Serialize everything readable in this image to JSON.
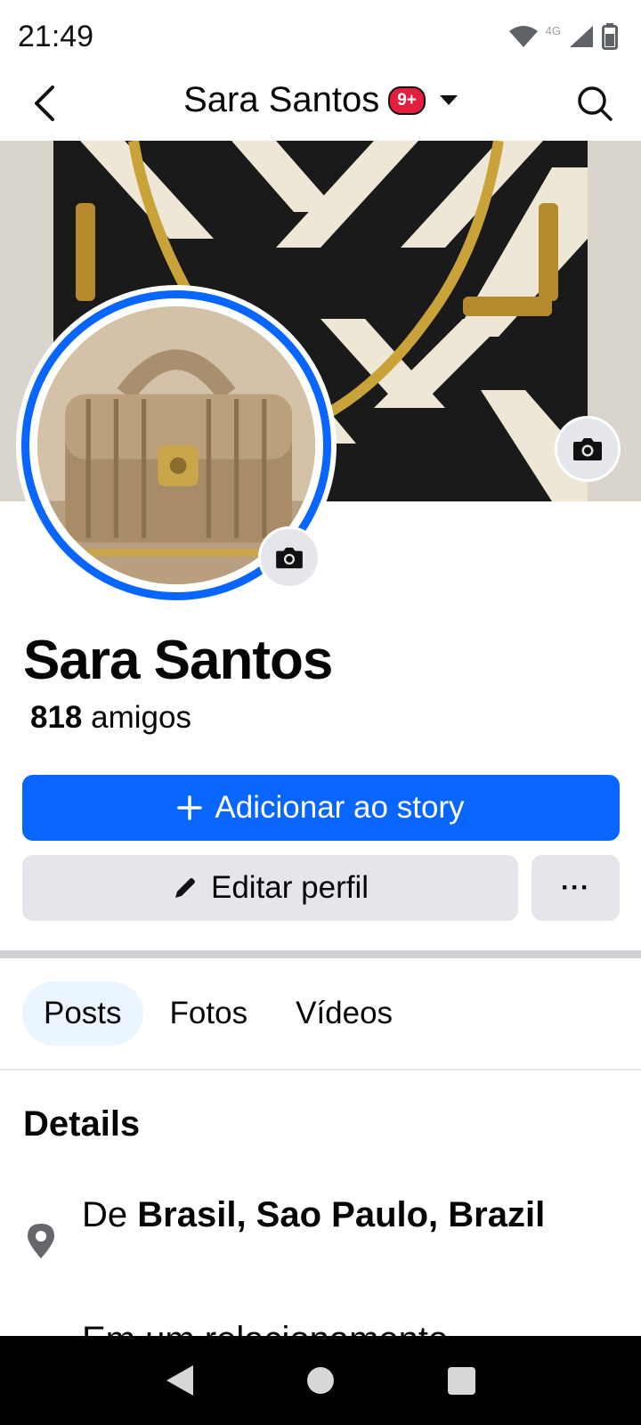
{
  "status_bar": {
    "time": "21:49",
    "network": "4G",
    "icons": [
      "wifi-icon",
      "cell-signal-icon",
      "battery-icon"
    ]
  },
  "header": {
    "back_icon": "chevron-left-icon",
    "title": "Sara Santos",
    "badge": "9+",
    "dropdown_icon": "caret-down-icon",
    "search_icon": "search-icon"
  },
  "profile": {
    "name": "Sara Santos",
    "friends_count": "818",
    "friends_label": "amigos",
    "camera_icon": "camera-icon"
  },
  "actions": {
    "add_story_label": "Adicionar ao story",
    "edit_profile_label": "Editar perfil",
    "more_label": "···"
  },
  "tabs": [
    {
      "label": "Posts",
      "active": true
    },
    {
      "label": "Fotos",
      "active": false
    },
    {
      "label": "Vídeos",
      "active": false
    }
  ],
  "details": {
    "title": "Details",
    "location_prefix": "De",
    "location_value": "Brasil, Sao Paulo, Brazil",
    "next_row_text": "Em um relacionamento"
  },
  "colors": {
    "accent": "#0866ff",
    "button_gray": "#e4e6eb",
    "badge_red": "#e41e3f",
    "tab_active_bg": "#ebf5ff"
  }
}
